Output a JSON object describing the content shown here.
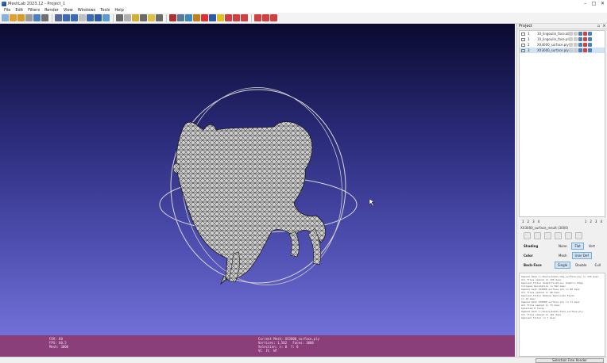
{
  "window": {
    "title": "MeshLab 2023.12 - Project_1",
    "minimize": "–",
    "maximize": "□",
    "close": "✕"
  },
  "menu": {
    "items": [
      "File",
      "Edit",
      "Filters",
      "Render",
      "View",
      "Windows",
      "Tools",
      "Help"
    ]
  },
  "toolbar": {
    "groups": [
      [
        "#8ab0d8",
        "#e0a030",
        "#d89a28",
        "#9a9a9a",
        "#4a7fc0",
        "#707070"
      ],
      [
        "#5a6a9a",
        "#3a6ab8",
        "#3a6ab8",
        "#c0c0c0",
        "#3a6ab8",
        "#2a5aa8",
        "#5a9ad8"
      ],
      [
        "#6a6a6a",
        "#b0b0b0",
        "#d0b030",
        "#6a6a6a",
        "#e0c040",
        "#6a6a6a"
      ],
      [
        "#b03030",
        "#5a7a9a",
        "#3a8ac0",
        "#c08020",
        "#e03030",
        "#2a5aa8",
        "#e0c020",
        "#d04040",
        "#d04040",
        "#d04040"
      ],
      [
        "#d04040",
        "#d04040",
        "#d04040"
      ]
    ]
  },
  "project_panel": {
    "title": "Project",
    "layers": [
      {
        "num": "1",
        "name": "10_lingoulin_face.obj",
        "selected": false
      },
      {
        "num": "1",
        "name": "10_lingoulin_face.ply",
        "selected": false
      },
      {
        "num": "2",
        "name": "XX4000_surface.ply",
        "selected": false
      },
      {
        "num": "3",
        "name": "XX3000_surface.ply",
        "selected": true
      }
    ],
    "nav_left": [
      "1",
      "2",
      "3",
      "4"
    ],
    "nav_right": [
      "1",
      "2",
      "3",
      "4"
    ]
  },
  "decorator": {
    "mesh_title": "XX3000_surface_result (3000)",
    "shading_label": "Shading",
    "shading_options": [
      {
        "label": "None",
        "active": false
      },
      {
        "label": "Flat",
        "active": true
      },
      {
        "label": "Vert",
        "active": false
      }
    ],
    "color_label": "Color",
    "color_options": [
      {
        "label": "Mesh",
        "active": false
      },
      {
        "label": "User Def",
        "active": true
      }
    ],
    "cull_label": "Back-Face",
    "cull_options": [
      {
        "label": "Single",
        "active": true
      },
      {
        "label": "Double",
        "active": false
      },
      {
        "label": "Cull",
        "active": false
      }
    ],
    "apply_label": "Apply to all visible Layers"
  },
  "log": {
    "lines": [
      "Opened mesh C:/Users/model/dog_surface.ply in 134 msec",
      "All files opened in 136 msec",
      "Applied filter Simplification: Quadric Edge",
      "Collapse Decimation in 562 msec",
      "Opened mesh XX4000_surface.ply in 88 msec",
      "All files opened in 90 msec",
      "Applied filter Remove Duplicate Faces",
      "in 12 msec",
      "Opened mesh XX3000_surface.ply in 71 msec",
      "All files opened in 73 msec",
      "Selected 0 faces",
      "Opened mesh C:/Users/model/face_surface.ply",
      "All files opened in 101 msec",
      "Applied filter in 7 msec"
    ]
  },
  "infobar": {
    "col1": [
      "FOV: 60",
      "FPS: 60.5",
      "Mesh: 3000"
    ],
    "col2": [
      "Current Mesh: XX3000_surface.ply",
      "Vertices: 1,502   Faces: 3000",
      "Selection: v: 0  f: 0",
      "VC  FC  WT"
    ]
  },
  "status": {
    "progress_label": "Selection Free Render"
  },
  "viewport": {
    "mesh_color": "#c8c8c8",
    "trackball_color": "#e0e0e0"
  }
}
